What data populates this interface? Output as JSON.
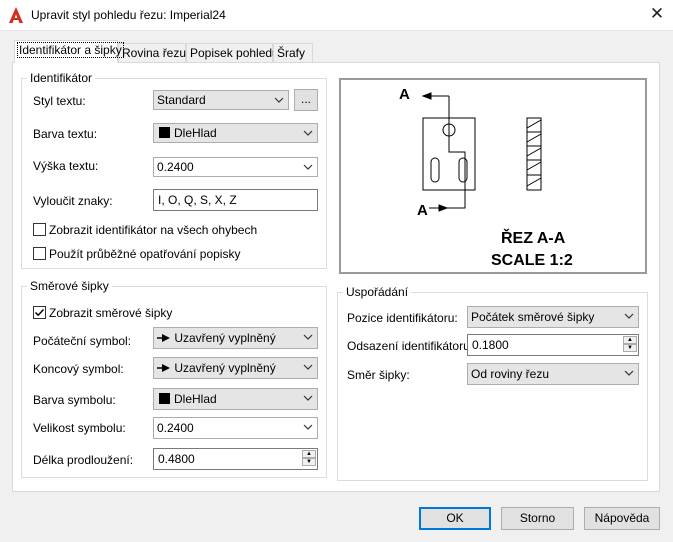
{
  "window": {
    "title": "Upravit styl pohledu řezu: Imperial24"
  },
  "tabs": [
    {
      "label": "Identifikátor a šipky"
    },
    {
      "label": "Rovina řezu"
    },
    {
      "label": "Popisek pohledu"
    },
    {
      "label": "Šrafy"
    }
  ],
  "identifier": {
    "legend": "Identifikátor",
    "text_style_label": "Styl textu:",
    "text_style_value": "Standard",
    "text_style_browse": "...",
    "text_color_label": "Barva textu:",
    "text_color_value": "DleHlad",
    "text_height_label": "Výška textu:",
    "text_height_value": "0.2400",
    "exclude_label": "Vyloučit znaky:",
    "exclude_value": "I, O, Q, S, X, Z",
    "show_all_bends_label": "Zobrazit identifikátor na všech ohybech",
    "show_all_bends_checked": false,
    "continuous_label": "Použít průběžné opatřování popisky",
    "continuous_checked": false
  },
  "arrows": {
    "legend": "Směrové šipky",
    "show_arrows_label": "Zobrazit směrové šipky",
    "show_arrows_checked": true,
    "start_symbol_label": "Počáteční symbol:",
    "start_symbol_value": "Uzavřený vyplněný",
    "end_symbol_label": "Koncový symbol:",
    "end_symbol_value": "Uzavřený vyplněný",
    "symbol_color_label": "Barva symbolu:",
    "symbol_color_value": "DleHlad",
    "symbol_size_label": "Velikost symbolu:",
    "symbol_size_value": "0.2400",
    "extension_label": "Délka prodloužení:",
    "extension_value": "0.4800"
  },
  "preview": {
    "letter_top": "A",
    "letter_bottom": "A",
    "section_title": "ŘEZ A-A",
    "scale_text": "SCALE 1:2"
  },
  "layout": {
    "legend": "Uspořádání",
    "position_label": "Pozice identifikátoru:",
    "position_value": "Počátek směrové šipky",
    "offset_label": "Odsazení identifikátoru:",
    "offset_value": "0.1800",
    "direction_label": "Směr šipky:",
    "direction_value": "Od roviny řezu"
  },
  "buttons": {
    "ok": "OK",
    "cancel": "Storno",
    "help": "Nápověda"
  },
  "colors": {
    "accent": "#0078d7",
    "app_icon": "#d62c1f"
  }
}
